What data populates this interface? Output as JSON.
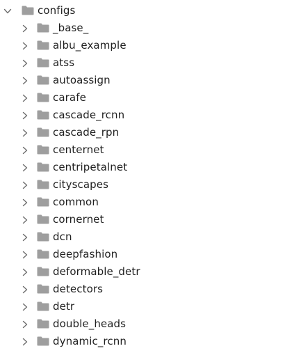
{
  "tree": {
    "root": {
      "label": "configs",
      "expanded": true,
      "icon": "folder-icon",
      "chevron": "chevron-down-icon"
    },
    "children": [
      {
        "label": "_base_",
        "expanded": false
      },
      {
        "label": "albu_example",
        "expanded": false
      },
      {
        "label": "atss",
        "expanded": false
      },
      {
        "label": "autoassign",
        "expanded": false
      },
      {
        "label": "carafe",
        "expanded": false
      },
      {
        "label": "cascade_rcnn",
        "expanded": false
      },
      {
        "label": "cascade_rpn",
        "expanded": false
      },
      {
        "label": "centernet",
        "expanded": false
      },
      {
        "label": "centripetalnet",
        "expanded": false
      },
      {
        "label": "cityscapes",
        "expanded": false
      },
      {
        "label": "common",
        "expanded": false
      },
      {
        "label": "cornernet",
        "expanded": false
      },
      {
        "label": "dcn",
        "expanded": false
      },
      {
        "label": "deepfashion",
        "expanded": false
      },
      {
        "label": "deformable_detr",
        "expanded": false
      },
      {
        "label": "detectors",
        "expanded": false
      },
      {
        "label": "detr",
        "expanded": false
      },
      {
        "label": "double_heads",
        "expanded": false
      },
      {
        "label": "dynamic_rcnn",
        "expanded": false
      }
    ]
  },
  "colors": {
    "folder": "#9e9e9e",
    "folder_tab": "#8f8f8f",
    "chevron": "#6e6e6e",
    "text": "#1f1f1f"
  }
}
